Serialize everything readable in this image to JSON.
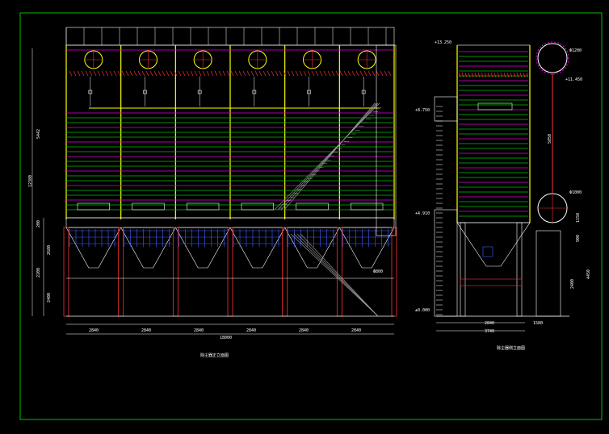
{
  "colors": {
    "background": "#000000",
    "frame": "#00c000",
    "outline": "#ffffff",
    "column": "#ffff00",
    "panel_green": "#00c000",
    "panel_magenta": "#e000e0",
    "fan_red": "#ff3030",
    "hopper_blue": "#4060ff",
    "stair_gray": "#a0a0a0"
  },
  "front_view": {
    "caption": "除尘器正立面图",
    "bay_dims": [
      "2840",
      "2840",
      "2840",
      "2840",
      "2840",
      "2840"
    ],
    "total_width": "18000",
    "left_dims": {
      "top": "5442",
      "upper_total": "12380",
      "mid": "200",
      "hopper": "2680",
      "lower": "2200",
      "base": "2400"
    },
    "side_label": "Ф800"
  },
  "side_view": {
    "caption": "除尘器侧立面图",
    "elevations": [
      "+13.250",
      "+11.450",
      "+8.750",
      "+4.910",
      "±0.000"
    ],
    "bottom_dims": [
      "2840",
      "3740",
      "1580"
    ],
    "duct_labels": [
      "Ф1200",
      "Ф1000"
    ],
    "right_dims": [
      "1150",
      "900",
      "4450",
      "2400"
    ],
    "inner_dim": "5850"
  }
}
